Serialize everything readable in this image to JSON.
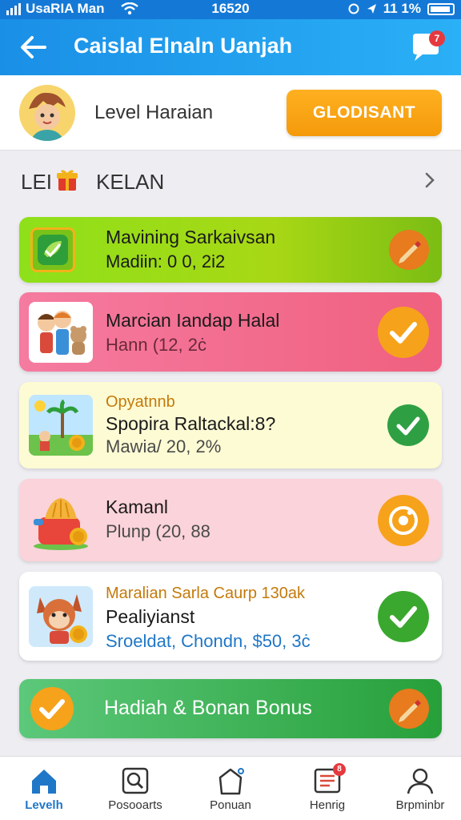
{
  "status_bar": {
    "carrier": "UsaRIA Man",
    "time": "16520",
    "battery": "11 1%"
  },
  "header": {
    "title": "Caislal Elnaln Uanjah",
    "chat_badge": "7"
  },
  "level": {
    "label": "Level Haraian",
    "button": "GLODISANT"
  },
  "section": {
    "prefix": "LEI",
    "title": "KELAN"
  },
  "cards": [
    {
      "title": "Mavining Sarkaivsan",
      "subtitle": "Madiin: 0 0, 2i2",
      "status": "pencil-icon"
    },
    {
      "title": "Marcian Iandap Halal",
      "subtitle": "Hann  (12, 2ċ",
      "status": "check-icon"
    },
    {
      "tag": "Opyatnnb",
      "title": "Spopira Raltackal:8?",
      "subtitle": "Mawia/ 20, 2%",
      "status": "check-icon"
    },
    {
      "title": "Kamanl",
      "subtitle": "Plunp  (20, 88",
      "status": "record-icon"
    },
    {
      "tag": "Maralian Sarla Caurp 130ak",
      "title": "Pealiyianst",
      "subtitle": "Sroeldat, Chondn, $50, 3ċ",
      "status": "check-icon"
    }
  ],
  "bonus": {
    "label": "Hadiah & Bonan Bonus"
  },
  "bottom_nav": [
    {
      "label": "Levelh",
      "icon": "home-icon"
    },
    {
      "label": "Posooarts",
      "icon": "search-icon"
    },
    {
      "label": "Ponuan",
      "icon": "bag-icon"
    },
    {
      "label": "Henrig",
      "icon": "inbox-icon",
      "badge": "8"
    },
    {
      "label": "Brpminbr",
      "icon": "user-icon"
    }
  ],
  "colors": {
    "primary": "#1a8fe6",
    "accent": "#f49a0b",
    "success": "#2ea043"
  }
}
